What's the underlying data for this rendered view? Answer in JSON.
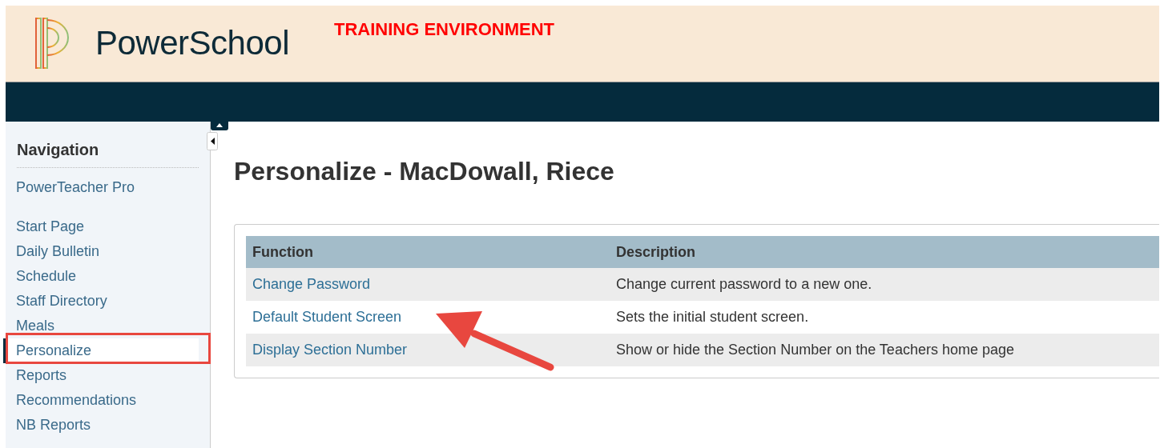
{
  "header": {
    "brand": "PowerSchool",
    "environment": "TRAINING ENVIRONMENT"
  },
  "sidebar": {
    "title": "Navigation",
    "top_link": "PowerTeacher Pro",
    "items": [
      {
        "label": "Start Page",
        "selected": false
      },
      {
        "label": "Daily Bulletin",
        "selected": false
      },
      {
        "label": "Schedule",
        "selected": false
      },
      {
        "label": "Staff Directory",
        "selected": false
      },
      {
        "label": "Meals",
        "selected": false
      },
      {
        "label": "Personalize",
        "selected": true
      },
      {
        "label": "Reports",
        "selected": false
      },
      {
        "label": "Recommendations",
        "selected": false
      },
      {
        "label": "NB Reports",
        "selected": false
      }
    ]
  },
  "page_title": "Personalize - MacDowall, Riece",
  "table": {
    "columns": [
      "Function",
      "Description"
    ],
    "rows": [
      {
        "function": "Change Password",
        "description": "Change current password to a new one."
      },
      {
        "function": "Default Student Screen",
        "description": "Sets the initial student screen."
      },
      {
        "function": "Display Section Number",
        "description": "Show or hide the Section Number on the Teachers home page"
      }
    ]
  }
}
